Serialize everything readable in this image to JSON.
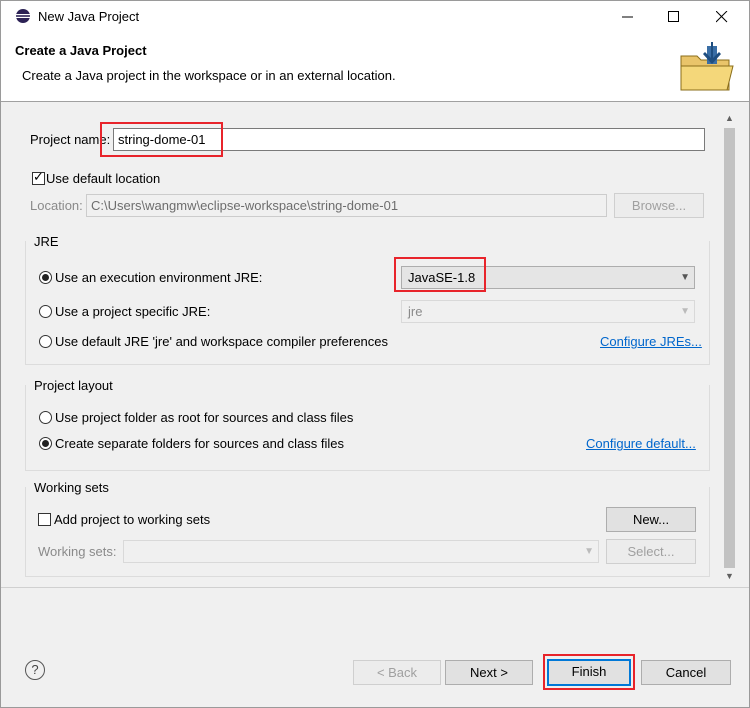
{
  "window": {
    "title": "New Java Project"
  },
  "header": {
    "title": "Create a Java Project",
    "description": "Create a Java project in the workspace or in an external location."
  },
  "project": {
    "name_label": "Project name:",
    "name_value": "string-dome-01",
    "use_default_location_label": "Use default location",
    "use_default_location_checked": true,
    "location_label": "Location:",
    "location_value": "C:\\Users\\wangmw\\eclipse-workspace\\string-dome-01",
    "browse_label": "Browse..."
  },
  "jre": {
    "group_title": "JRE",
    "option_execution_env_label": "Use an execution environment JRE:",
    "execution_env_value": "JavaSE-1.8",
    "option_project_specific_label": "Use a project specific JRE:",
    "project_specific_value": "jre",
    "option_default_label": "Use default JRE 'jre' and workspace compiler preferences",
    "configure_jres_link": "Configure JREs...",
    "selected": "execution_env"
  },
  "project_layout": {
    "group_title": "Project layout",
    "option_root_label": "Use project folder as root for sources and class files",
    "option_separate_label": "Create separate folders for sources and class files",
    "configure_default_link": "Configure default...",
    "selected": "separate"
  },
  "working_sets": {
    "group_title": "Working sets",
    "add_label": "Add project to working sets",
    "add_checked": false,
    "new_button": "New...",
    "working_sets_label": "Working sets:",
    "working_sets_value": "",
    "select_button": "Select..."
  },
  "footer": {
    "back_label": "< Back",
    "next_label": "Next >",
    "finish_label": "Finish",
    "cancel_label": "Cancel"
  },
  "colors": {
    "highlight": "#e8242b",
    "link": "#0066cc",
    "focus": "#0078d7"
  }
}
